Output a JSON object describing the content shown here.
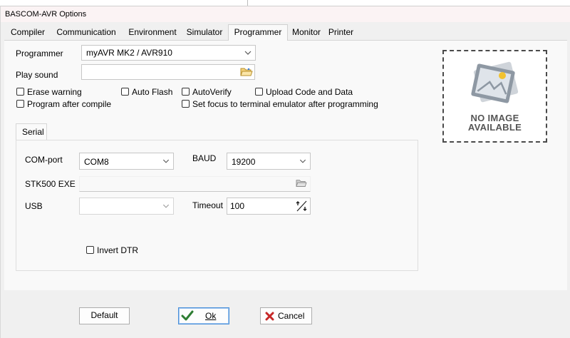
{
  "window": {
    "title": "BASCOM-AVR Options"
  },
  "tabs": [
    {
      "label": "Compiler"
    },
    {
      "label": "Communication"
    },
    {
      "label": "Environment"
    },
    {
      "label": "Simulator"
    },
    {
      "label": "Programmer"
    },
    {
      "label": "Monitor"
    },
    {
      "label": "Printer"
    }
  ],
  "programmer": {
    "programmer_label": "Programmer",
    "programmer_value": "myAVR MK2 / AVR910",
    "play_sound_label": "Play sound",
    "play_sound_value": "",
    "checkboxes": {
      "erase_warning": "Erase warning",
      "auto_flash": "Auto Flash",
      "auto_verify": "AutoVerify",
      "upload_code": "Upload Code and Data",
      "program_after_compile": "Program after compile",
      "set_focus": "Set focus to terminal emulator after programming"
    }
  },
  "serial": {
    "tab_label": "Serial",
    "com_port_label": "COM-port",
    "com_port_value": "COM8",
    "baud_label": "BAUD",
    "baud_value": "19200",
    "stk500_label": "STK500 EXE",
    "stk500_value": "",
    "usb_label": "USB",
    "usb_value": "",
    "timeout_label": "Timeout",
    "timeout_value": "100",
    "invert_dtr_label": "Invert DTR"
  },
  "image_placeholder": {
    "line1": "NO IMAGE",
    "line2": "AVAILABLE"
  },
  "buttons": {
    "default_label": "Default",
    "ok_label": "Ok",
    "cancel_label": "Cancel"
  },
  "colors": {
    "ok_check": "#2e7d32",
    "cancel_x": "#c62828",
    "focus_border": "#4a90d9"
  }
}
